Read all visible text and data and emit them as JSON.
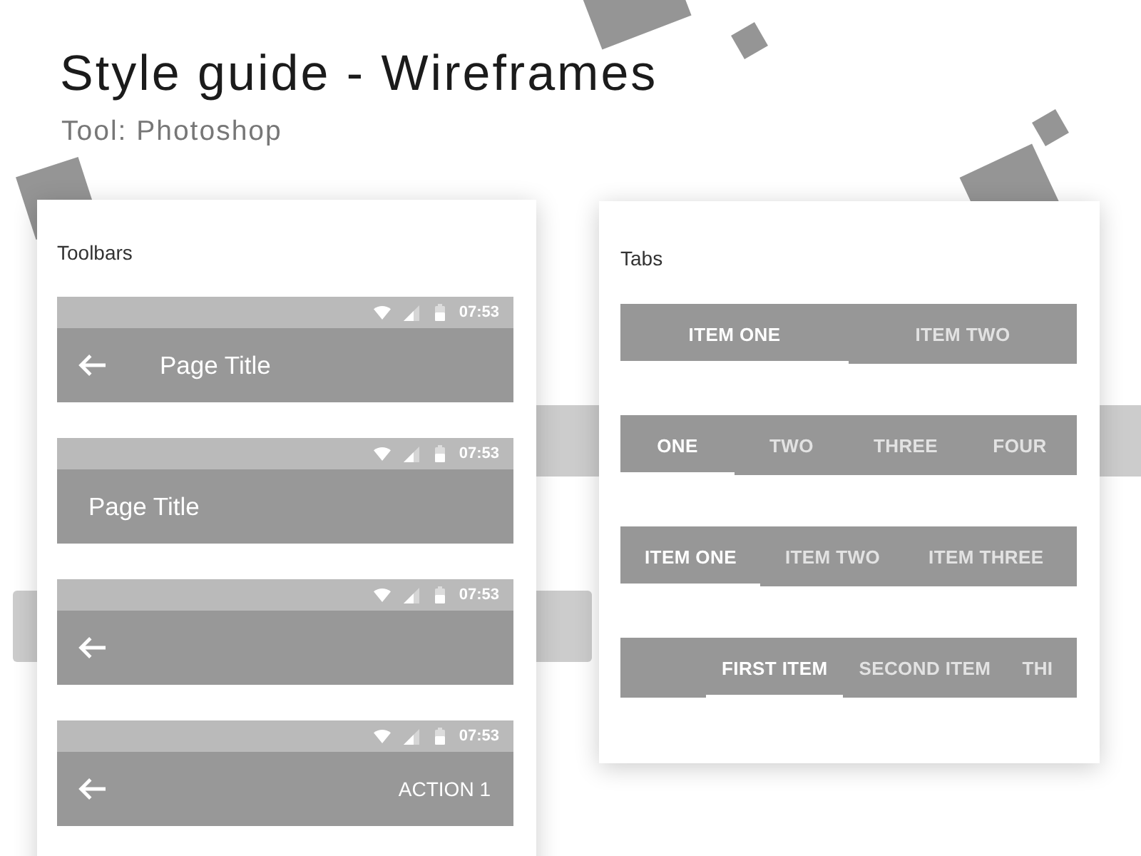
{
  "title": "Style guide - Wireframes",
  "subtitle": "Tool: Photoshop",
  "toolbars_card": {
    "heading": "Toolbars",
    "toolbars": [
      {
        "status_time": "07:53",
        "back_arrow": true,
        "title": "Page Title"
      },
      {
        "status_time": "07:53",
        "back_arrow": false,
        "title": "Page Title"
      },
      {
        "status_time": "07:53",
        "back_arrow": true
      },
      {
        "status_time": "07:53",
        "back_arrow": true,
        "action": "ACTION 1"
      }
    ]
  },
  "tabs_card": {
    "heading": "Tabs",
    "tab_bars": [
      {
        "kind": "fixed",
        "tabs": [
          {
            "label": "ITEM ONE",
            "selected": true
          },
          {
            "label": "ITEM TWO",
            "selected": false
          }
        ]
      },
      {
        "kind": "fixed",
        "tabs": [
          {
            "label": "ONE",
            "selected": true
          },
          {
            "label": "TWO",
            "selected": false
          },
          {
            "label": "THREE",
            "selected": false
          },
          {
            "label": "FOUR",
            "selected": false
          }
        ]
      },
      {
        "kind": "scrollable",
        "tabs": [
          {
            "label": "ITEM ONE",
            "selected": true
          },
          {
            "label": "ITEM TWO",
            "selected": false
          },
          {
            "label": "ITEM THREE",
            "selected": false
          }
        ]
      },
      {
        "kind": "offset",
        "tabs": [
          {
            "label": "FIRST ITEM",
            "selected": true
          },
          {
            "label": "SECOND ITEM",
            "selected": false
          },
          {
            "label": "THI",
            "selected": false
          }
        ]
      }
    ]
  }
}
